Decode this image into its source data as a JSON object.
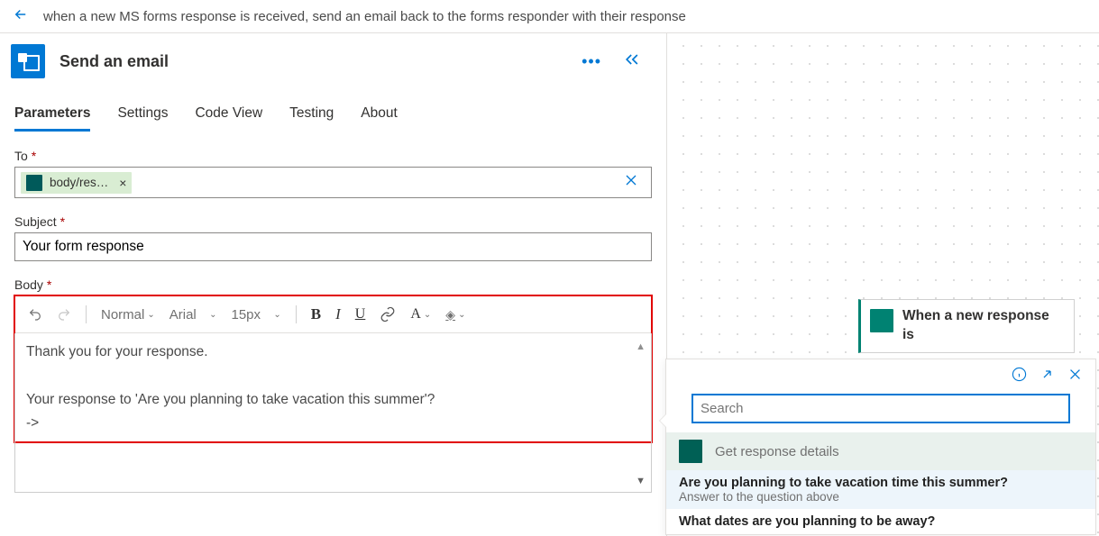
{
  "header": {
    "flow_title": "when a new MS forms response is received, send an email back to the forms responder with their response"
  },
  "action": {
    "title": "Send an email"
  },
  "tabs": {
    "parameters": "Parameters",
    "settings": "Settings",
    "code_view": "Code View",
    "testing": "Testing",
    "about": "About"
  },
  "fields": {
    "to_label": "To",
    "to_token": "body/res…",
    "subject_label": "Subject",
    "subject_value": "Your form response",
    "body_label": "Body"
  },
  "rte": {
    "style": "Normal",
    "font": "Arial",
    "size": "15px",
    "bold": "B",
    "italic": "I",
    "underline": "U",
    "link": "🔗",
    "fontcolor": "A",
    "highlight": "◇",
    "line1": "Thank you for your response.",
    "line2": "Your response to 'Are you planning to take vacation this summer'?",
    "line3": "->"
  },
  "canvas_card": {
    "title": "When a new response is"
  },
  "popover": {
    "search_placeholder": "Search",
    "section_title": "Get response details",
    "items": [
      {
        "title": "Are you planning to take vacation time this summer?",
        "sub": "Answer to the question above"
      },
      {
        "title": "What dates are you planning to be away?",
        "sub": ""
      }
    ]
  }
}
